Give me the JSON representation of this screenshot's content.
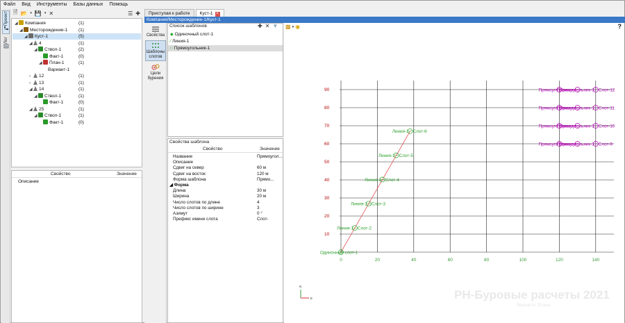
{
  "menu": [
    "Файл",
    "Вид",
    "Инструменты",
    "Базы данных",
    "Помощь"
  ],
  "vertical_tabs": [
    "Проект",
    "Лог"
  ],
  "tree": {
    "rows": [
      {
        "label": "Компания",
        "count": "(1)",
        "level": 0,
        "icon": "company-icon",
        "expanded": true
      },
      {
        "label": "Месторождение-1",
        "count": "(1)",
        "level": 1,
        "icon": "field-icon",
        "expanded": true
      },
      {
        "label": "Куст-1",
        "count": "(5)",
        "level": 2,
        "icon": "pad-icon",
        "expanded": true,
        "selected": true
      },
      {
        "label": "4",
        "count": "(1)",
        "level": 3,
        "icon": "well-icon",
        "expanded": true
      },
      {
        "label": "Ствол-1",
        "count": "(2)",
        "level": 4,
        "icon": "wellbore-icon",
        "expanded": true
      },
      {
        "label": "Факт-1",
        "count": "(0)",
        "level": 5,
        "icon": "fact-icon"
      },
      {
        "label": "План-1",
        "count": "(1)",
        "level": 5,
        "icon": "plan-icon",
        "expanded": true
      },
      {
        "label": "Вариант-1",
        "count": "",
        "level": 6,
        "icon": ""
      },
      {
        "label": "12",
        "count": "(1)",
        "level": 3,
        "icon": "well-icon",
        "expanded": false
      },
      {
        "label": "13",
        "count": "(1)",
        "level": 3,
        "icon": "well-icon",
        "expanded": false
      },
      {
        "label": "14",
        "count": "(1)",
        "level": 3,
        "icon": "well-icon",
        "expanded": true
      },
      {
        "label": "Ствол-1",
        "count": "(1)",
        "level": 4,
        "icon": "wellbore-icon",
        "expanded": true
      },
      {
        "label": "Факт-1",
        "count": "(0)",
        "level": 5,
        "icon": "fact-icon"
      },
      {
        "label": "25",
        "count": "(1)",
        "level": 3,
        "icon": "well-icon",
        "expanded": true
      },
      {
        "label": "Ствол-1",
        "count": "(1)",
        "level": 4,
        "icon": "wellbore-icon",
        "expanded": true
      },
      {
        "label": "Факт-1",
        "count": "(0)",
        "level": 5,
        "icon": "fact-icon"
      }
    ]
  },
  "left_props": {
    "col_property": "Свойство",
    "col_value": "Значение",
    "rows": [
      "Описание"
    ]
  },
  "tabs": [
    {
      "label": "Приступая к работе",
      "active": false
    },
    {
      "label": "Куст-1",
      "active": true
    }
  ],
  "breadcrumb": "Компания/Месторождение-1/Куст-1",
  "side_buttons": [
    "Свойства",
    "Шаблоны слотов",
    "Цели бурения"
  ],
  "templates": {
    "title": "Список шаблонов",
    "items": [
      {
        "label": "Одиночный слот-1",
        "icon": "single-slot-icon"
      },
      {
        "label": "Линия-1",
        "icon": "line-icon"
      },
      {
        "label": "Прямоугольник-1",
        "icon": "rect-grid-icon",
        "selected": true
      }
    ]
  },
  "template_props": {
    "title": "Свойства шаблона",
    "col_property": "Свойство",
    "col_value": "Значение",
    "rows": [
      {
        "name": "Название",
        "value": "Прямоугол..."
      },
      {
        "name": "Описание",
        "value": ""
      },
      {
        "name": "Сдвиг на север",
        "value": "60 м"
      },
      {
        "name": "Сдвиг на восток",
        "value": "120 м"
      },
      {
        "name": "Форма шаблона",
        "value": "Прямо..."
      },
      {
        "name": "Форма",
        "value": "",
        "group": true
      },
      {
        "name": "Длина",
        "value": "30 м"
      },
      {
        "name": "Ширина",
        "value": "20 м"
      },
      {
        "name": "Число слотов по длине",
        "value": "4"
      },
      {
        "name": "Число слотов по ширине",
        "value": "3"
      },
      {
        "name": "Азимут",
        "value": "0 °"
      },
      {
        "name": "Префикс имени слота",
        "value": "Слот-"
      }
    ]
  },
  "watermark": {
    "title": "РН-Буровые расчеты 2021",
    "subtitle": "Версия от 30 мая"
  },
  "help": "?",
  "axis_letters": {
    "north": "N",
    "east": "E"
  },
  "chart_data": {
    "type": "scatter",
    "x_ticks": [
      "0",
      "20",
      "40",
      "60",
      "80",
      "100",
      "120",
      "140"
    ],
    "y_ticks": [
      "10",
      "20",
      "30",
      "40",
      "50",
      "60",
      "70",
      "80",
      "90"
    ],
    "xlim": [
      0,
      150
    ],
    "ylim": [
      0,
      95
    ],
    "grid": true,
    "colors": {
      "line": "#e45050",
      "slot_green": "#2ea02e",
      "slot_magenta": "#b000b0",
      "tick": "#b00000",
      "xtick": "#3a9a3a"
    },
    "line": {
      "from": [
        0,
        0
      ],
      "to": [
        38,
        67
      ]
    },
    "points": [
      {
        "x": 0,
        "y": 0,
        "label": "Одиночный слот-1",
        "color": "green"
      },
      {
        "x": 7.6,
        "y": 13.4,
        "label": "Линия-1",
        "suffix": "Слот-2",
        "color": "green"
      },
      {
        "x": 15.2,
        "y": 26.8,
        "label": "Линия-1",
        "suffix": "Слот-3",
        "color": "green"
      },
      {
        "x": 22.8,
        "y": 40.2,
        "label": "Линия-1",
        "suffix": "Слот-4",
        "color": "green"
      },
      {
        "x": 30.4,
        "y": 53.6,
        "label": "Линия-1",
        "suffix": "Слот-5",
        "color": "green"
      },
      {
        "x": 38,
        "y": 67,
        "label": "Линия-1",
        "suffix": "Слот-6",
        "color": "green"
      },
      {
        "x": 120,
        "y": 60,
        "label": "Прямоуго",
        "color": "magenta"
      },
      {
        "x": 130,
        "y": 60,
        "label": "Прямоуго",
        "color": "magenta"
      },
      {
        "x": 140,
        "y": 60,
        "label": "Прямоугольник-1",
        "suffix": "Слот-9",
        "color": "magenta"
      },
      {
        "x": 120,
        "y": 70,
        "label": "Прямоуго",
        "color": "magenta"
      },
      {
        "x": 130,
        "y": 70,
        "label": "Прямоуго",
        "color": "magenta"
      },
      {
        "x": 140,
        "y": 70,
        "label": "Прямоугольник-1",
        "suffix": "Слот-10",
        "color": "magenta"
      },
      {
        "x": 120,
        "y": 80,
        "label": "Прямоуго",
        "color": "magenta"
      },
      {
        "x": 130,
        "y": 80,
        "label": "Прямоуго",
        "color": "magenta"
      },
      {
        "x": 140,
        "y": 80,
        "label": "Прямоугольник-1",
        "suffix": "Слот-11",
        "color": "magenta"
      },
      {
        "x": 120,
        "y": 90,
        "label": "Прямоуго",
        "color": "magenta"
      },
      {
        "x": 130,
        "y": 90,
        "label": "Прямоуго",
        "color": "magenta"
      },
      {
        "x": 140,
        "y": 90,
        "label": "Прямоугольник-1",
        "suffix": "Слот-12",
        "color": "magenta"
      }
    ]
  }
}
